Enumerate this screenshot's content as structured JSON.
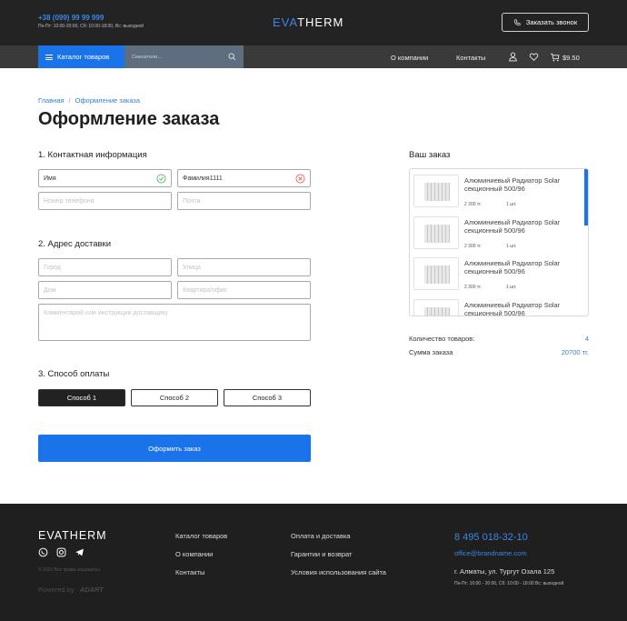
{
  "header": {
    "phone": "+38 (099) 99 99 999",
    "hours": "Пн-Пт: 10:00-20:00, Сб: 10:00-18:00, Вс: выходной",
    "logo_part1": "EVA",
    "logo_part2": "THERM",
    "call_button": "Заказать звонок"
  },
  "nav": {
    "catalog": "Каталог товаров",
    "search_placeholder": "Смесители...",
    "links": [
      "О компании",
      "Контакты"
    ],
    "cart_total": "$9.50"
  },
  "breadcrumb": [
    "Главная",
    "Оформление заказа"
  ],
  "page_title": "Оформление заказа",
  "contact": {
    "heading": "1. Контактная информация",
    "first_name": "Имя",
    "last_name": "Фамилия1111",
    "phone_placeholder": "Номер телефона",
    "email_placeholder": "Почта"
  },
  "delivery": {
    "heading": "2. Адрес доставки",
    "city_placeholder": "Город",
    "street_placeholder": "Улица",
    "house_placeholder": "Дом",
    "apt_placeholder": "Квартира/офис",
    "comment_placeholder": "Комментарий или инструкции доставщику"
  },
  "payment": {
    "heading": "3. Способ оплаты",
    "methods": [
      "Способ 1",
      "Способ 2",
      "Способ 3"
    ],
    "selected": 0
  },
  "submit_label": "Оформить заказ",
  "order": {
    "heading": "Ваш заказ",
    "items": [
      {
        "name": "Алюминиевый Радиатор Solar секционный 500/96",
        "price": "2 300 тг.",
        "qty": "1 шт."
      },
      {
        "name": "Алюминиевый Радиатор Solar секционный 500/96",
        "price": "2 300 тг.",
        "qty": "1 шт."
      },
      {
        "name": "Алюминиевый Радиатор Solar секционный 500/96",
        "price": "2 300 тг.",
        "qty": "1 шт."
      },
      {
        "name": "Алюминиевый Радиатор Solar секционный 500/96",
        "price": "",
        "qty": ""
      }
    ],
    "count_label": "Количество товаров:",
    "count_value": "4",
    "sum_label": "Сумма заказа",
    "sum_value": "20700 тг."
  },
  "footer": {
    "logo": "EVATHERM",
    "copyright": "© 2023 Все права защищены",
    "powered_by": "Powered by",
    "powered_brand": "ADART",
    "col1": [
      "Каталог товаров",
      "О компании",
      "Контакты"
    ],
    "col2": [
      "Оплата и доставка",
      "Гарантии и возврат",
      "Условия использования сайта"
    ],
    "phone": "8 495 018-32-10",
    "email": "office@brandname.com",
    "address": "г. Алматы, ул. Тургут Озала 125",
    "hours": "Пн-Пт: 10:00 - 20:00, Сб: 10:00 - 18:00 Вс: выходной"
  },
  "colors": {
    "accent": "#1a73e8",
    "dark": "#232323",
    "success": "#4caf50",
    "error": "#e05252"
  }
}
